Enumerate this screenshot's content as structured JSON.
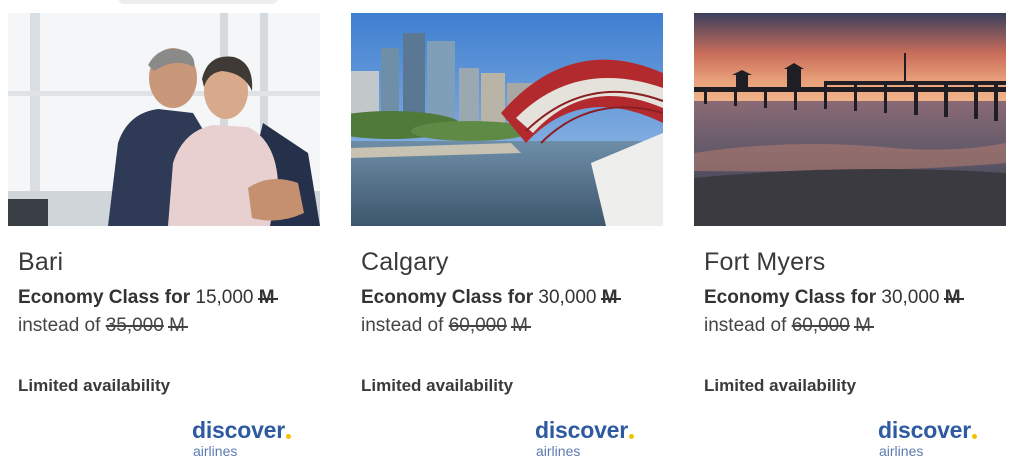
{
  "offers": [
    {
      "city": "Bari",
      "cabin_label": "Economy Class for",
      "price": "15,000",
      "currency_symbol": "M",
      "instead_label": "instead of",
      "old_price": "35,000",
      "availability": "Limited availability",
      "brand": {
        "word": "discover",
        "sub": "airlines"
      },
      "image_subject": "couple-by-window"
    },
    {
      "city": "Calgary",
      "cabin_label": "Economy Class for",
      "price": "30,000",
      "currency_symbol": "M",
      "instead_label": "instead of",
      "old_price": "60,000",
      "availability": "Limited availability",
      "brand": {
        "word": "discover",
        "sub": "airlines"
      },
      "image_subject": "city-skyline-red-bridge"
    },
    {
      "city": "Fort Myers",
      "cabin_label": "Economy Class for",
      "price": "30,000",
      "currency_symbol": "M",
      "instead_label": "instead of",
      "old_price": "60,000",
      "availability": "Limited availability",
      "brand": {
        "word": "discover",
        "sub": "airlines"
      },
      "image_subject": "pier-at-sunset"
    }
  ],
  "colors": {
    "brand_blue": "#2d5aa0",
    "brand_dot": "#f2c200",
    "text": "#333333"
  }
}
